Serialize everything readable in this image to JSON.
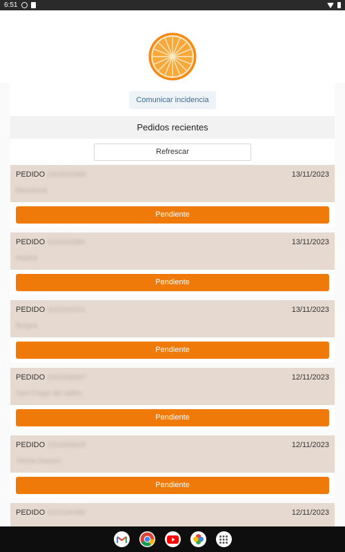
{
  "status_bar": {
    "time": "6:51"
  },
  "actions": {
    "incidence_label": "Comunicar incidencia"
  },
  "section": {
    "title": "Pedidos recientes",
    "refresh_label": "Refrescar"
  },
  "orders": [
    {
      "prefix": "PEDIDO",
      "id": "1023102089",
      "city": "Barcelona",
      "date": "13/11/2023",
      "status": "Pendiente"
    },
    {
      "prefix": "PEDIDO",
      "id": "1023102856",
      "city": "Madrid",
      "date": "13/11/2023",
      "status": "Pendiente"
    },
    {
      "prefix": "PEDIDO",
      "id": "1023102201",
      "city": "Burgos",
      "date": "13/11/2023",
      "status": "Pendiente"
    },
    {
      "prefix": "PEDIDO",
      "id": "1021030097",
      "city": "Sant Cugat del Vallès",
      "date": "12/11/2023",
      "status": "Pendiente"
    },
    {
      "prefix": "PEDIDO",
      "id": "1023103019",
      "city": "Vitoria-Gasteiz",
      "date": "12/11/2023",
      "status": "Pendiente"
    },
    {
      "prefix": "PEDIDO",
      "id": "1023104480",
      "city": "",
      "date": "12/11/2023",
      "status": ""
    }
  ],
  "colors": {
    "accent": "#ef7a0a",
    "order_bg": "#e6dad0"
  },
  "dock": {
    "apps": [
      "gmail-icon",
      "chrome-icon",
      "youtube-icon",
      "photos-icon",
      "app-drawer-icon"
    ]
  }
}
